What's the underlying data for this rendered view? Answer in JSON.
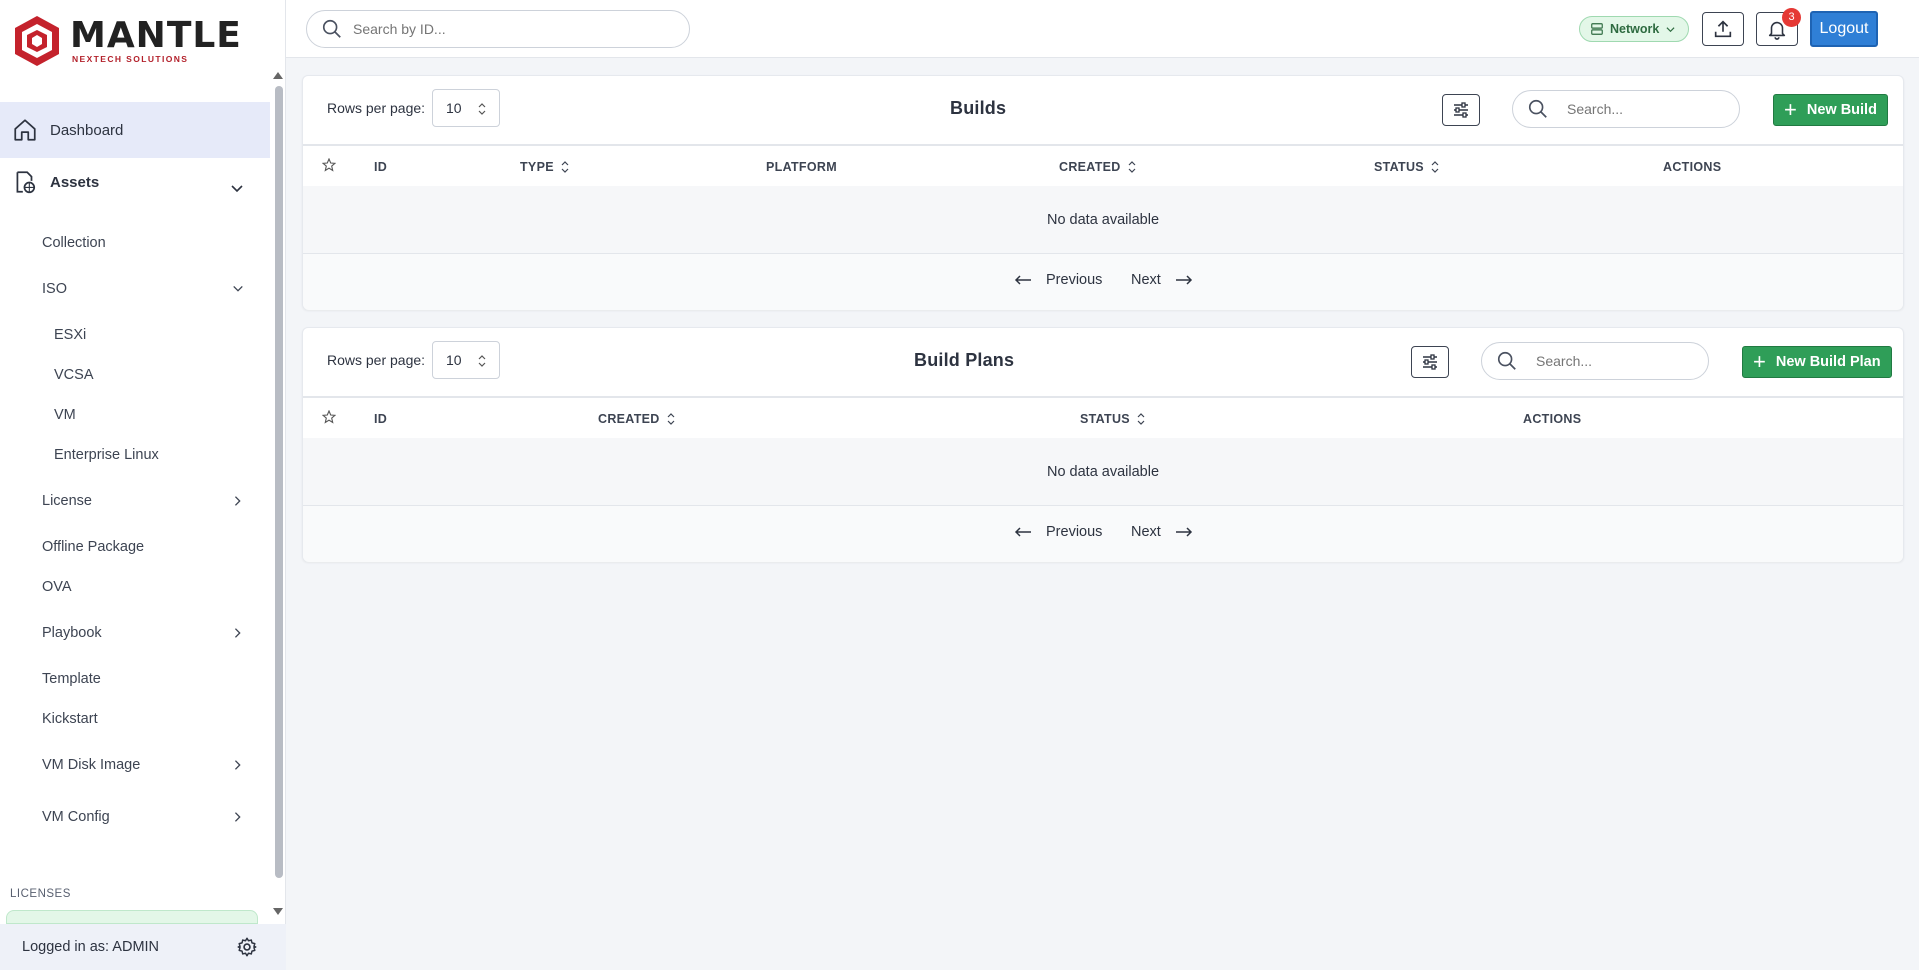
{
  "brand": {
    "name": "MANTLE",
    "tagline": "NEXTECH SOLUTIONS",
    "accent": "#b3212b"
  },
  "search": {
    "placeholder": "Search by ID..."
  },
  "topbar": {
    "network_label": "Network",
    "notification_count": "3",
    "logout_label": "Logout"
  },
  "sidebar": {
    "dashboard": "Dashboard",
    "assets": "Assets",
    "items": {
      "collection": "Collection",
      "iso": "ISO",
      "esxi": "ESXi",
      "vcsa": "VCSA",
      "vm": "VM",
      "enterprise_linux": "Enterprise Linux",
      "license": "License",
      "offline_package": "Offline Package",
      "ova": "OVA",
      "playbook": "Playbook",
      "template": "Template",
      "kickstart": "Kickstart",
      "vm_disk_image": "VM Disk Image",
      "vm_config": "VM Config"
    },
    "licenses_label": "LICENSES",
    "logged_in": "Logged in as: ADMIN"
  },
  "builds": {
    "rows_per_page_label": "Rows per page:",
    "rows_per_page": "10",
    "title": "Builds",
    "search_placeholder": "Search...",
    "new_label": "New Build",
    "columns": [
      "ID",
      "TYPE",
      "PLATFORM",
      "CREATED",
      "STATUS",
      "ACTIONS"
    ],
    "empty": "No data available",
    "prev": "Previous",
    "next": "Next"
  },
  "build_plans": {
    "rows_per_page_label": "Rows per page:",
    "rows_per_page": "10",
    "title": "Build Plans",
    "search_placeholder": "Search...",
    "new_label": "New Build Plan",
    "columns": [
      "ID",
      "CREATED",
      "STATUS",
      "ACTIONS"
    ],
    "empty": "No data available",
    "prev": "Previous",
    "next": "Next"
  }
}
